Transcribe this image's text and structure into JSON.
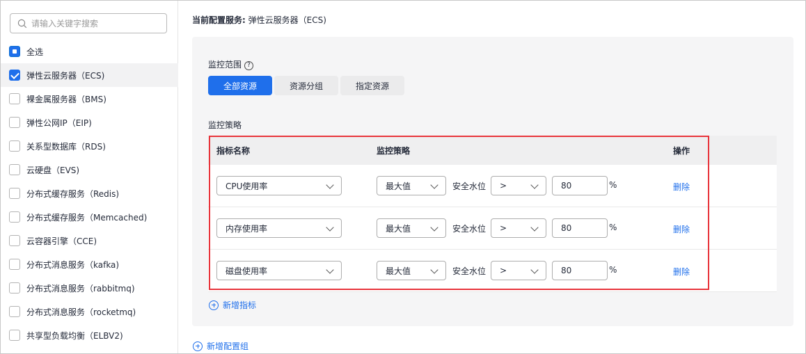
{
  "search": {
    "placeholder": "请输入关键字搜索"
  },
  "sidebar": {
    "items": [
      {
        "label": "全选",
        "state": "partial"
      },
      {
        "label": "弹性云服务器（ECS)",
        "state": "checked"
      },
      {
        "label": "裸金属服务器（BMS)",
        "state": "unchecked"
      },
      {
        "label": "弹性公网IP（EIP)",
        "state": "unchecked"
      },
      {
        "label": "关系型数据库（RDS)",
        "state": "unchecked"
      },
      {
        "label": "云硬盘（EVS)",
        "state": "unchecked"
      },
      {
        "label": "分布式缓存服务（Redis)",
        "state": "unchecked"
      },
      {
        "label": "分布式缓存服务（Memcached)",
        "state": "unchecked"
      },
      {
        "label": "云容器引擎（CCE)",
        "state": "unchecked"
      },
      {
        "label": "分布式消息服务（kafka)",
        "state": "unchecked"
      },
      {
        "label": "分布式消息服务（rabbitmq)",
        "state": "unchecked"
      },
      {
        "label": "分布式消息服务（rocketmq)",
        "state": "unchecked"
      },
      {
        "label": "共享型负载均衡（ELBV2)",
        "state": "unchecked"
      }
    ]
  },
  "main": {
    "config_label": "当前配置服务:",
    "config_value": "弹性云服务器（ECS)",
    "scope_label": "监控范围",
    "scope_tabs": [
      "全部资源",
      "资源分组",
      "指定资源"
    ],
    "policy_label": "监控策略",
    "table": {
      "headers": {
        "metric": "指标名称",
        "policy": "监控策略",
        "action": "操作"
      },
      "rows": [
        {
          "metric": "CPU使用率",
          "agg": "最大值",
          "threshold_label": "安全水位",
          "op": ">",
          "value": "80",
          "unit": "%",
          "action": "删除"
        },
        {
          "metric": "内存使用率",
          "agg": "最大值",
          "threshold_label": "安全水位",
          "op": ">",
          "value": "80",
          "unit": "%",
          "action": "删除"
        },
        {
          "metric": "磁盘使用率",
          "agg": "最大值",
          "threshold_label": "安全水位",
          "op": ">",
          "value": "80",
          "unit": "%",
          "action": "删除"
        }
      ]
    },
    "add_metric": "新增指标",
    "add_group": "新增配置组"
  },
  "colors": {
    "primary": "#1f6feb",
    "highlight": "#e8333a"
  }
}
